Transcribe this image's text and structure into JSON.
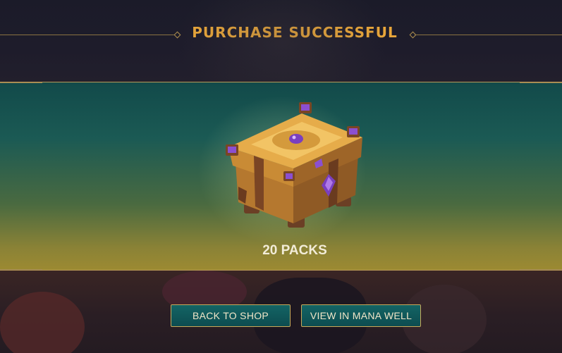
{
  "header": {
    "title": "PURCHASE SUCCESSFUL"
  },
  "reward": {
    "item_icon": "treasure-chest",
    "quantity_label": "20 PACKS"
  },
  "actions": {
    "back_label": "BACK TO SHOP",
    "mana_label": "VIEW IN MANA WELL"
  },
  "colors": {
    "title_gold": "#e8a63a",
    "button_teal": "#136464",
    "button_border": "#c9a959"
  }
}
